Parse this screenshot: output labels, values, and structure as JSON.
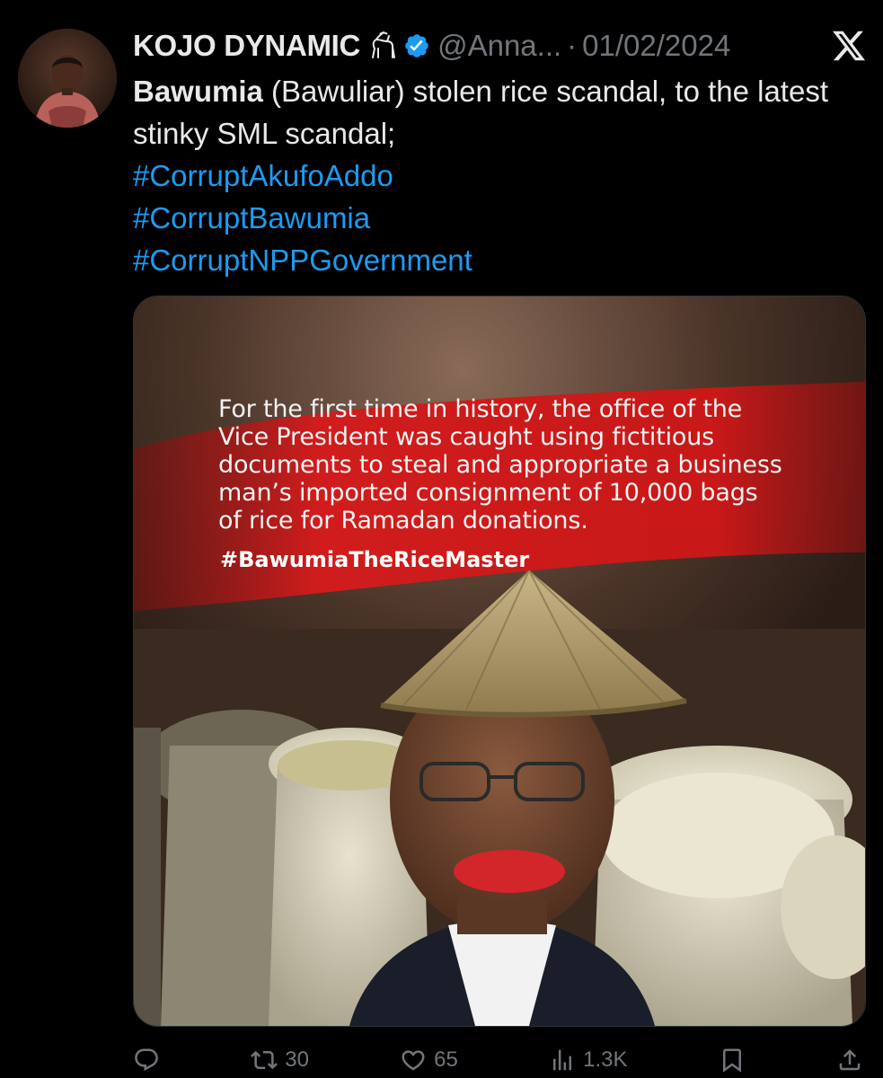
{
  "tweet": {
    "display_name": "KOJO DYNAMIC",
    "name_emoji": "goat-icon",
    "verified": true,
    "handle": "@Anna...",
    "separator": "·",
    "date": "01/02/2024",
    "text_bold": "Bawumia",
    "text_rest": " (Bawuliar) stolen rice scandal, to the latest stinky SML scandal;",
    "hashtags": [
      "#CorruptAkufoAddo",
      "#CorruptBawumia",
      "#CorruptNPPGovernment"
    ]
  },
  "media": {
    "caption_lines": [
      "For the first time in history, the office of the",
      "Vice President was caught using fictitious",
      "documents to steal and appropriate a business",
      "man’s imported consignment of 10,000 bags",
      "of rice for Ramadan donations."
    ],
    "hashtag": "#BawumiaTheRiceMaster"
  },
  "actions": {
    "reply_icon": "reply-icon",
    "retweet_count": "30",
    "like_count": "65",
    "views_count": "1.3K",
    "bookmark_icon": "bookmark-icon",
    "share_icon": "share-icon"
  },
  "colors": {
    "background": "#000000",
    "text": "#e7e9ea",
    "muted": "#71767b",
    "link": "#1d9bf0",
    "verified": "#1d9bf0",
    "banner_red": "#d01c1c"
  }
}
